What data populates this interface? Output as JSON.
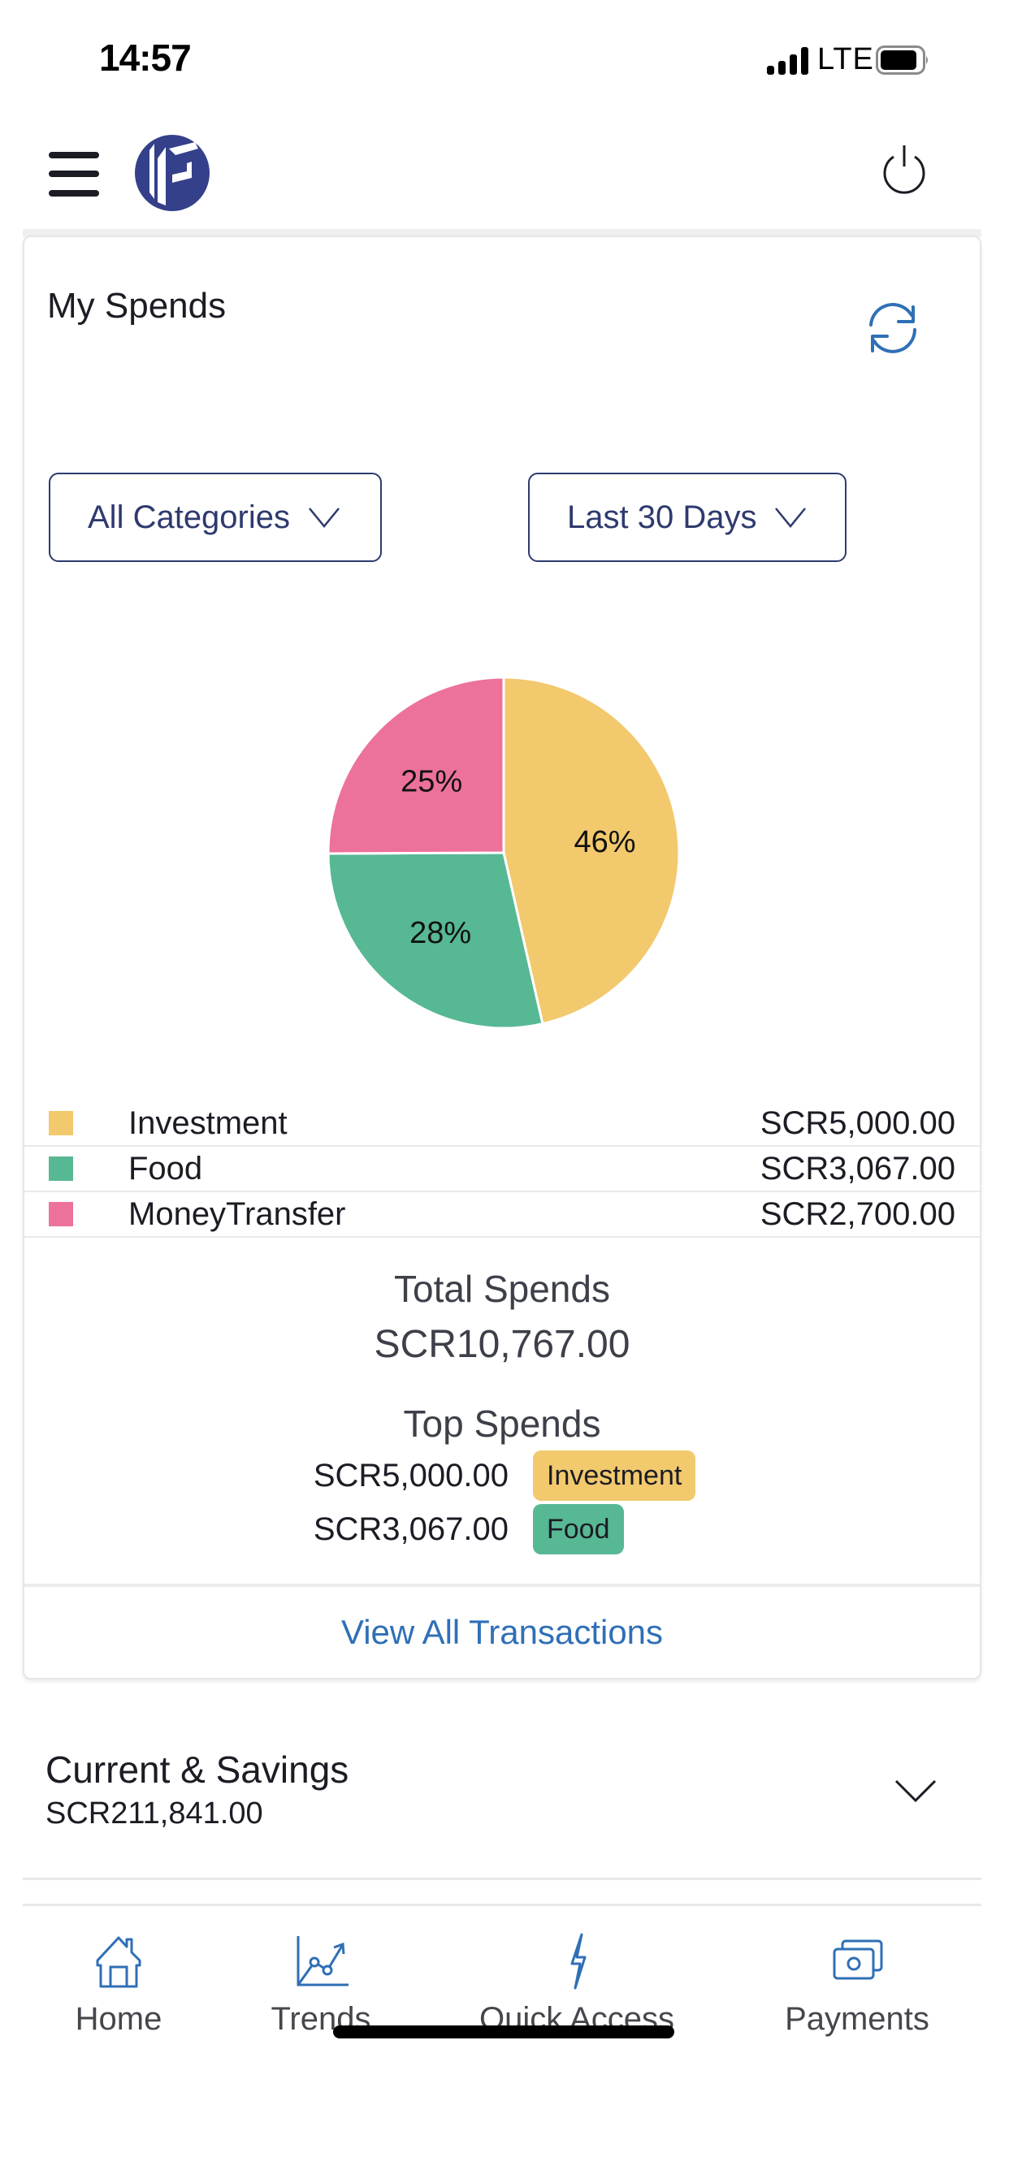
{
  "status_bar": {
    "time": "14:57",
    "network": "LTE",
    "signal_icon": "signal-bars-icon",
    "battery_icon": "battery-icon"
  },
  "header": {
    "menu_icon": "hamburger-menu-icon",
    "logo": "bank-logo",
    "power_icon": "power-icon"
  },
  "spends_card": {
    "title": "My Spends",
    "refresh_icon": "refresh-icon",
    "filters": {
      "category": {
        "selected": "All Categories"
      },
      "period": {
        "selected": "Last 30 Days"
      }
    },
    "colors": {
      "Investment": "#F2C96D",
      "Food": "#57B894",
      "MoneyTransfer": "#EC729B"
    },
    "legend": [
      {
        "name": "Investment",
        "amount": "SCR5,000.00",
        "color": "#F2C96D"
      },
      {
        "name": "Food",
        "amount": "SCR3,067.00",
        "color": "#57B894"
      },
      {
        "name": "MoneyTransfer",
        "amount": "SCR2,700.00",
        "color": "#EC729B"
      }
    ],
    "total_label": "Total Spends",
    "total_value": "SCR10,767.00",
    "top_label": "Top Spends",
    "top_spends": [
      {
        "amount": "SCR5,000.00",
        "category": "Investment",
        "color": "#F2C96D"
      },
      {
        "amount": "SCR3,067.00",
        "category": "Food",
        "color": "#57B894"
      }
    ],
    "view_all_label": "View All Transactions"
  },
  "chart_data": {
    "type": "pie",
    "title": "",
    "categories": [
      "Investment",
      "Food",
      "MoneyTransfer"
    ],
    "values": [
      5000.0,
      3067.0,
      2700.0
    ],
    "percent_labels": [
      "46%",
      "28%",
      "25%"
    ],
    "colors": [
      "#F2C96D",
      "#57B894",
      "#EC729B"
    ],
    "start_angle": "12 o'clock",
    "direction": "clockwise",
    "legend": "below"
  },
  "accounts": {
    "title": "Current & Savings",
    "amount": "SCR211,841.00",
    "expand_icon": "chevron-down-icon"
  },
  "bottom_nav": {
    "items": [
      {
        "label": "Home",
        "icon": "home-icon"
      },
      {
        "label": "Trends",
        "icon": "trends-chart-icon"
      },
      {
        "label": "Quick Access",
        "icon": "lightning-bolt-icon"
      },
      {
        "label": "Payments",
        "icon": "payments-cash-icon"
      }
    ]
  }
}
